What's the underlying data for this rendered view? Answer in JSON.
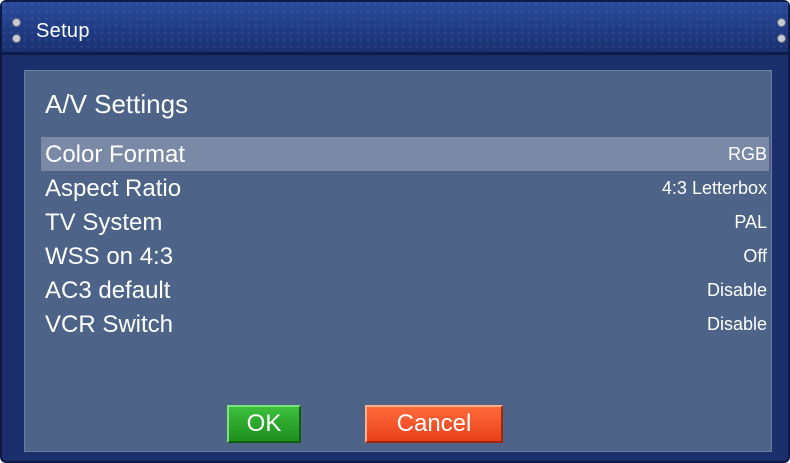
{
  "window": {
    "title": "Setup"
  },
  "panel": {
    "title": "A/V Settings"
  },
  "settings": [
    {
      "label": "Color Format",
      "value": "RGB",
      "selected": true
    },
    {
      "label": "Aspect Ratio",
      "value": "4:3 Letterbox",
      "selected": false
    },
    {
      "label": "TV System",
      "value": "PAL",
      "selected": false
    },
    {
      "label": "WSS on 4:3",
      "value": "Off",
      "selected": false
    },
    {
      "label": "AC3 default",
      "value": "Disable",
      "selected": false
    },
    {
      "label": "VCR Switch",
      "value": "Disable",
      "selected": false
    }
  ],
  "buttons": {
    "ok_label": "OK",
    "cancel_label": "Cancel"
  },
  "colors": {
    "window_bg": "#1a2f6b",
    "panel_bg": "#4d6488",
    "selected_row": "#7a8aa6",
    "ok_green": "#2aa52a",
    "cancel_orange": "#f24e22"
  }
}
